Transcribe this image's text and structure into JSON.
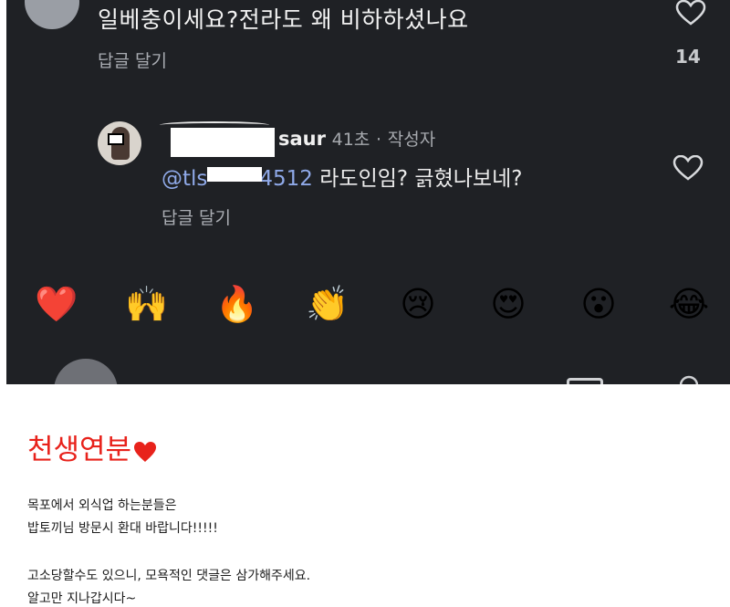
{
  "screenshot": {
    "comment1": {
      "text": "일베충이세요?전라도 왜 비하하셨나요",
      "reply_label": "답글 달기",
      "like_count": "14"
    },
    "comment2": {
      "username_suffix": "saur",
      "time": "41초",
      "separator": "·",
      "author_tag": "작성자",
      "mention_prefix": "@tls",
      "mention_suffix": "4512",
      "text": " 라도인임? 긁혔나보네?",
      "reply_label": "답글 달기"
    },
    "emoji_bar": [
      "❤️",
      "🙌",
      "🔥",
      "👏",
      "😢",
      "😍",
      "😮",
      "😂"
    ]
  },
  "post": {
    "title": "천생연분",
    "lines": [
      "목포에서 외식업 하는분들은",
      "밥토끼님 방문시 환대 바랍니다!!!!!",
      "고소당할수도 있으니, 모욕적인 댓글은 삼가해주세요.",
      "알고만 지나갑시다~"
    ]
  },
  "colors": {
    "dark_bg": "#1f2125",
    "title_red": "#e8221b",
    "mention_blue": "#8fa9e8"
  }
}
